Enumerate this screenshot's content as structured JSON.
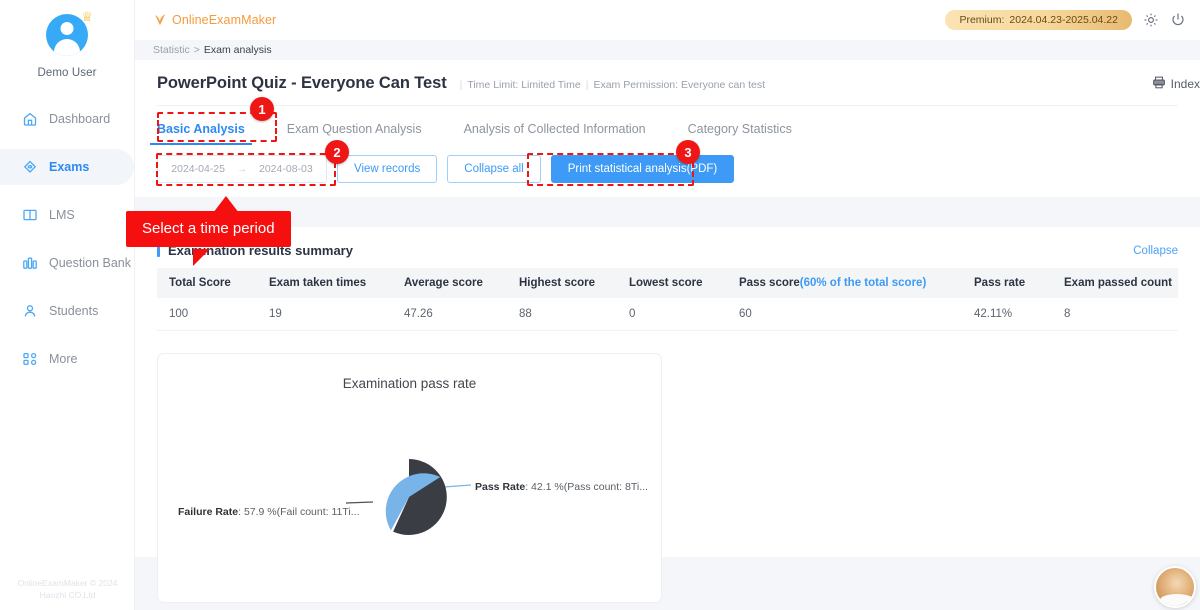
{
  "sidebar": {
    "user_name": "Demo User",
    "avatar_icon": "user-avatar-icon",
    "crown_icon": "crown-badge-icon",
    "items": [
      {
        "label": "Dashboard",
        "icon": "home-icon"
      },
      {
        "label": "Exams",
        "icon": "diamond-icon"
      },
      {
        "label": "LMS",
        "icon": "book-icon"
      },
      {
        "label": "Question Bank",
        "icon": "bar-chart-icon"
      },
      {
        "label": "Students",
        "icon": "person-icon"
      },
      {
        "label": "More",
        "icon": "grid-dots-icon"
      }
    ],
    "footer_line1": "OnlineExamMaker © 2024",
    "footer_line2": "Haozhi CO.Ltd"
  },
  "topbar": {
    "brand": "OnlineExamMaker",
    "brand_icon": "checkmark-brand-icon",
    "premium_label": "Premium:",
    "premium_value": "2024.04.23-2025.04.22",
    "settings_icon": "gear-icon",
    "power_icon": "power-icon"
  },
  "breadcrumb": {
    "root": "Statistic",
    "separator": ">",
    "current": "Exam analysis"
  },
  "exam": {
    "title": "PowerPoint Quiz - Everyone Can Test",
    "time_limit": "Time Limit: Limited Time",
    "permission": "Exam Permission: Everyone can test",
    "index_label": "Index",
    "index_icon": "printer-icon"
  },
  "tabs": [
    {
      "label": "Basic Analysis",
      "active": true
    },
    {
      "label": "Exam Question Analysis",
      "active": false
    },
    {
      "label": "Analysis of Collected Information",
      "active": false
    },
    {
      "label": "Category Statistics",
      "active": false
    }
  ],
  "toolbar": {
    "date_start": "2024-04-25",
    "date_arrow": "→",
    "date_end": "2024-08-03",
    "view_records": "View records",
    "collapse_all": "Collapse all",
    "print_pdf": "Print statistical analysis(PDF)"
  },
  "summary": {
    "section_title": "Examination results summary",
    "collapse_link": "Collapse",
    "headers": [
      "Total Score",
      "Exam taken times",
      "Average score",
      "Highest score",
      "Lowest score",
      "Pass score",
      "Pass rate",
      "Exam passed count"
    ],
    "pass_score_hint": "(60% of the total score)",
    "row": [
      "100",
      "19",
      "47.26",
      "88",
      "0",
      "60",
      "42.11%",
      "8"
    ]
  },
  "chart_data": {
    "type": "pie",
    "title": "Examination pass rate",
    "categories": [
      "Pass Rate",
      "Failure Rate"
    ],
    "values": [
      42.1,
      57.9
    ],
    "colors": [
      "#79b4e8",
      "#3a3d44"
    ],
    "labels": [
      {
        "name": "Pass Rate",
        "text": ": 42.1 %(Pass count: 8Ti..."
      },
      {
        "name": "Failure Rate",
        "text": ": 57.9 %(Fail count: 11Ti..."
      }
    ],
    "legend": "none",
    "start_angle_deg": 0
  },
  "annotations": {
    "badge_1": "1",
    "badge_2": "2",
    "badge_3": "3",
    "callout": "Select a time period",
    "color": "#f01515"
  }
}
